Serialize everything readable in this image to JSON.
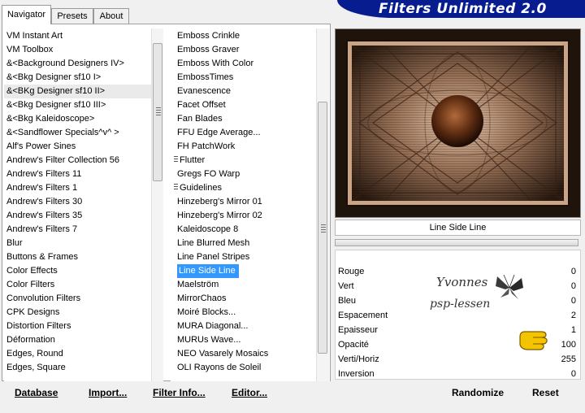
{
  "tabs": [
    "Navigator",
    "Presets",
    "About"
  ],
  "app_title": "Filters Unlimited 2.0",
  "categories": [
    "VM Instant Art",
    "VM Toolbox",
    "&<Background Designers IV>",
    "&<Bkg Designer sf10 I>",
    "&<BKg Designer sf10 II>",
    "&<Bkg Designer sf10 III>",
    "&<Bkg Kaleidoscope>",
    "&<Sandflower Specials^v^ >",
    "Alf's Power Sines",
    "Andrew's Filter Collection 56",
    "Andrew's Filters 11",
    "Andrew's Filters 1",
    "Andrew's Filters 30",
    "Andrew's Filters 35",
    "Andrew's Filters 7",
    "Blur",
    "Buttons & Frames",
    "Color Effects",
    "Color Filters",
    "Convolution Filters",
    "CPK Designs",
    "Distortion Filters",
    "Déformation",
    "Edges, Round",
    "Edges, Square"
  ],
  "selected_category": "&<BKg Designer sf10 II>",
  "filters": [
    {
      "label": "Emboss Crinkle",
      "folder": false
    },
    {
      "label": "Emboss Graver",
      "folder": false
    },
    {
      "label": "Emboss With Color",
      "folder": false
    },
    {
      "label": "EmbossTimes",
      "folder": false
    },
    {
      "label": "Evanescence",
      "folder": false
    },
    {
      "label": "Facet Offset",
      "folder": false
    },
    {
      "label": "Fan Blades",
      "folder": false
    },
    {
      "label": "FFU Edge Average...",
      "folder": false
    },
    {
      "label": "FH PatchWork",
      "folder": false
    },
    {
      "label": "Flutter",
      "folder": true
    },
    {
      "label": "Gregs FO Warp",
      "folder": false
    },
    {
      "label": "Guidelines",
      "folder": true
    },
    {
      "label": "Hinzeberg's Mirror 01",
      "folder": false
    },
    {
      "label": "Hinzeberg's Mirror 02",
      "folder": false
    },
    {
      "label": "Kaleidoscope 8",
      "folder": false
    },
    {
      "label": "Line Blurred Mesh",
      "folder": false
    },
    {
      "label": "Line Panel Stripes",
      "folder": false
    },
    {
      "label": "Line Side Line",
      "folder": false
    },
    {
      "label": "Maelström",
      "folder": false
    },
    {
      "label": "MirrorChaos",
      "folder": false
    },
    {
      "label": "Moiré Blocks...",
      "folder": false
    },
    {
      "label": "MURA Diagonal...",
      "folder": false
    },
    {
      "label": "MURUs Wave...",
      "folder": false
    },
    {
      "label": "NEO Vasarely Mosaics",
      "folder": false
    },
    {
      "label": "OLI Rayons de Soleil",
      "folder": false
    }
  ],
  "selected_filter": "Line Side Line",
  "preview_label": "Line Side Line",
  "params": [
    {
      "name": "Rouge",
      "value": "0"
    },
    {
      "name": "Vert",
      "value": "0"
    },
    {
      "name": "Bleu",
      "value": "0"
    },
    {
      "name": "Espacement",
      "value": "2"
    },
    {
      "name": "Epaisseur",
      "value": "1"
    },
    {
      "name": "Opacité",
      "value": "100"
    },
    {
      "name": "Verti/Horiz",
      "value": "255"
    },
    {
      "name": "Inversion",
      "value": "0"
    }
  ],
  "watermark": {
    "line1": "Yvonnes",
    "line2": "psp-lessen"
  },
  "buttons": {
    "database": "Database",
    "import": "Import...",
    "filter_info": "Filter Info...",
    "editor": "Editor...",
    "randomize": "Randomize",
    "reset": "Reset"
  },
  "colors": {
    "banner": "#071d8f",
    "selection": "#3399ff",
    "preview_dark": "#2a1a10",
    "preview_light": "#c9a487"
  }
}
